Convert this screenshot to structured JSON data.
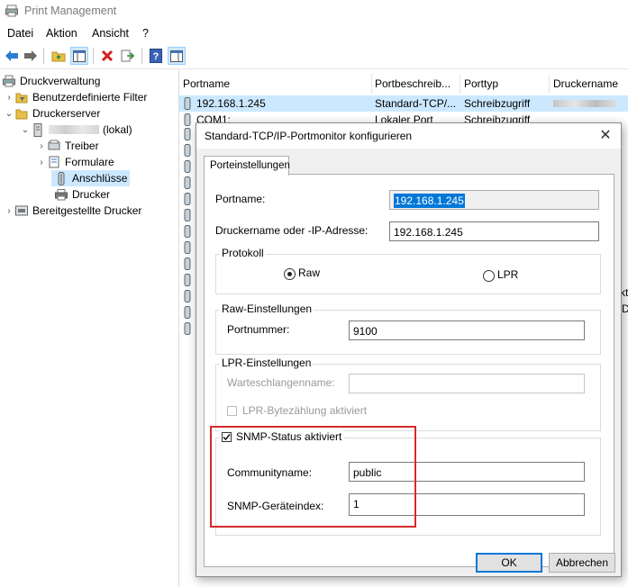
{
  "window": {
    "title": "Print Management"
  },
  "menu": {
    "items": [
      "Datei",
      "Aktion",
      "Ansicht",
      "?"
    ]
  },
  "toolbar": {
    "buttons": [
      "back-arrow",
      "forward-arrow",
      "folder-up",
      "show-hide-tree",
      "delete",
      "export",
      "help",
      "properties"
    ]
  },
  "tree": {
    "root": "Druckverwaltung",
    "custom_filters": "Benutzerdefinierte Filter",
    "print_servers": "Druckerserver",
    "server_name_suffix": "(lokal)",
    "drivers": "Treiber",
    "forms": "Formulare",
    "ports": "Anschlüsse",
    "printers": "Drucker",
    "deployed": "Bereitgestellte Drucker"
  },
  "list": {
    "columns": [
      "Portname",
      "Portbeschreib...",
      "Porttyp",
      "Druckername"
    ],
    "rows": [
      {
        "name": "192.168.1.245",
        "desc": "Standard-TCP/...",
        "type": "Schreibzugriff"
      },
      {
        "name": "COM1:",
        "desc": "Lokaler Port",
        "type": "Schreibzugriff"
      }
    ],
    "right_edge_fragments": [
      "kt",
      "D"
    ]
  },
  "dialog": {
    "title": "Standard-TCP/IP-Portmonitor konfigurieren",
    "tab_label": "Porteinstellungen",
    "portname_label": "Portname:",
    "portname_value": "192.168.1.245",
    "address_label": "Druckername oder -IP-Adresse:",
    "address_value": "192.168.1.245",
    "protocol_group": "Protokoll",
    "raw_label": "Raw",
    "lpr_label": "LPR",
    "selected_protocol": "Raw",
    "raw_group": "Raw-Einstellungen",
    "port_number_label": "Portnummer:",
    "port_number_value": "9100",
    "lpr_group": "LPR-Einstellungen",
    "queue_label": "Warteschlangenname:",
    "queue_value": "",
    "lpr_byte_count_label": "LPR-Bytezählung aktiviert",
    "lpr_byte_count_checked": false,
    "snmp_label": "SNMP-Status aktiviert",
    "snmp_checked": true,
    "community_label": "Communityname:",
    "community_value": "public",
    "device_index_label": "SNMP-Geräteindex:",
    "device_index_value": "1",
    "ok_label": "OK",
    "cancel_label": "Abbrechen"
  },
  "colors": {
    "selection": "#cce8ff",
    "highlight_box": "#d42a2a",
    "default_button_border": "#0078d7",
    "text_selection": "#0078d7"
  }
}
